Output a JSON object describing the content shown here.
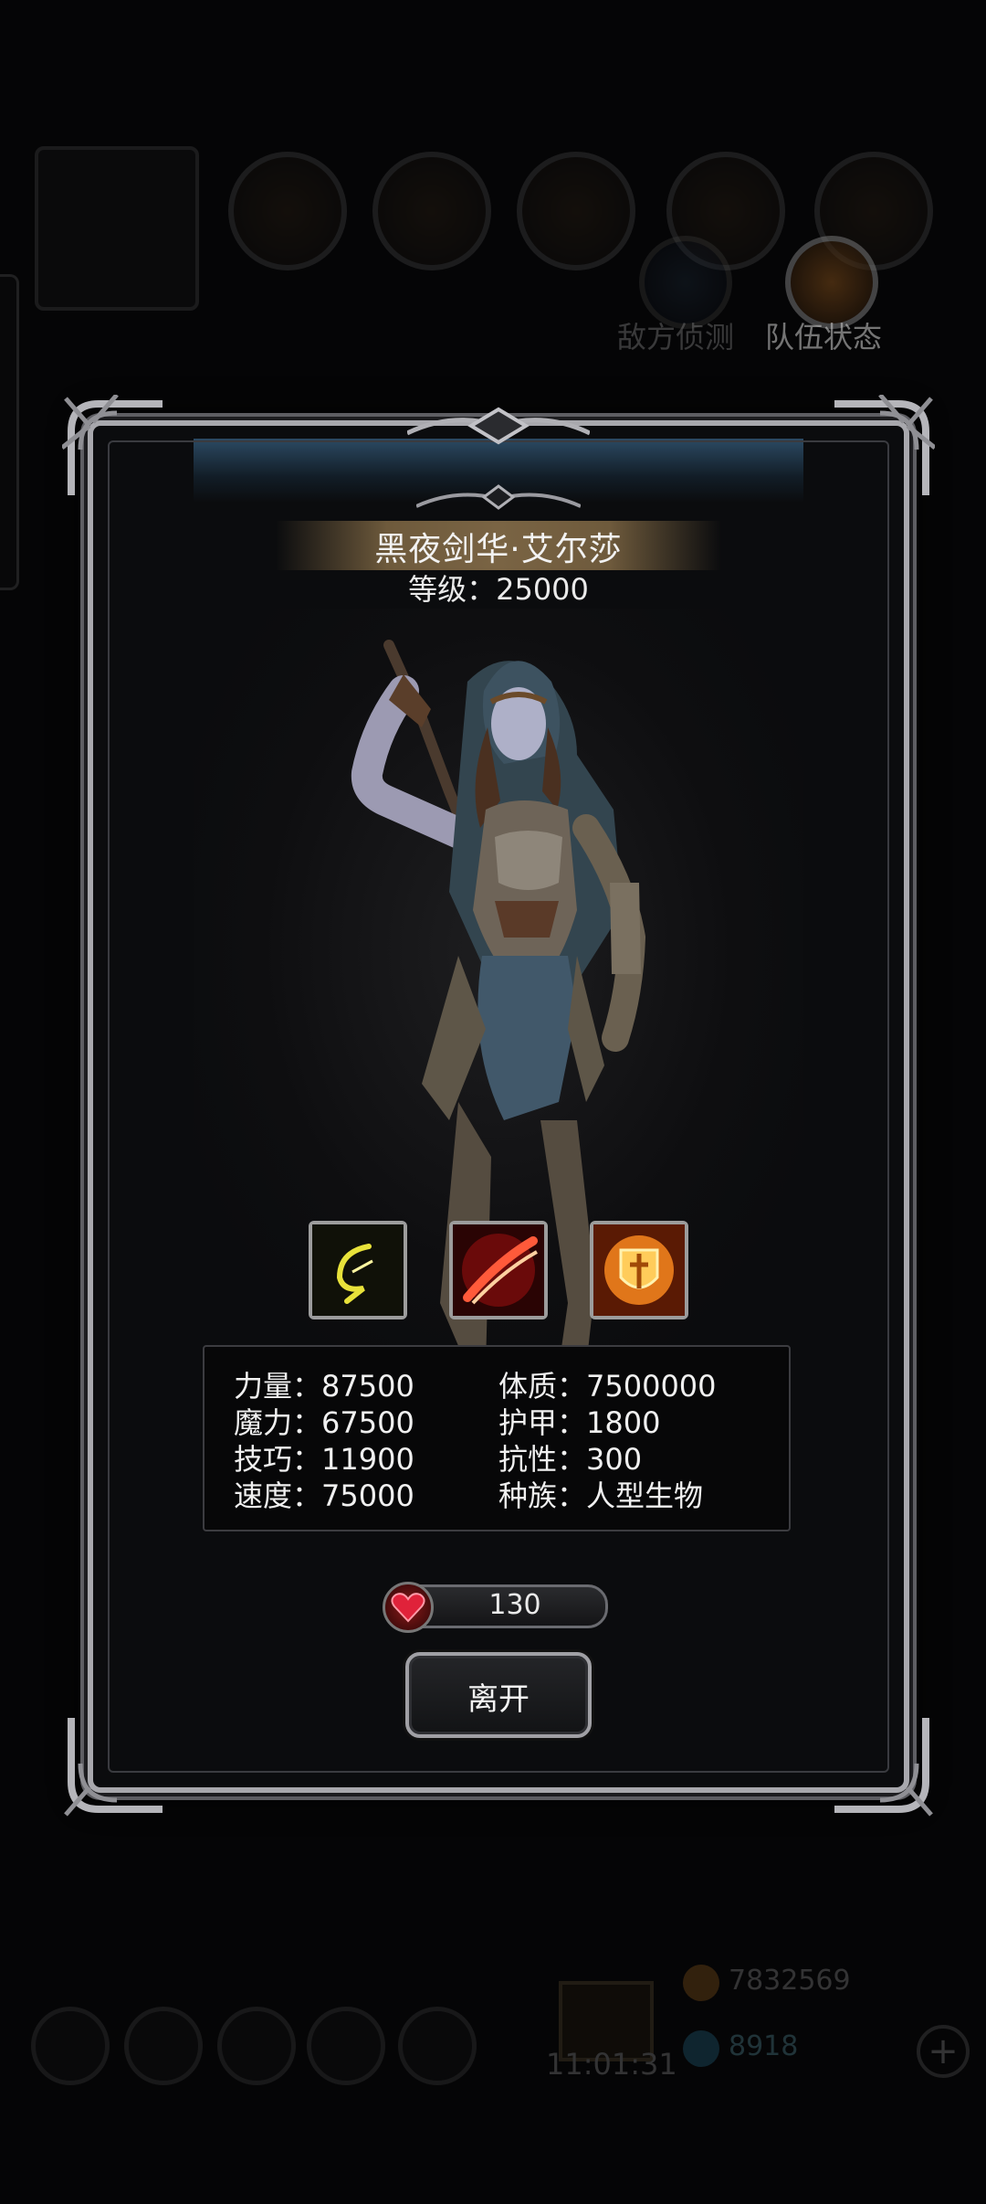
{
  "background": {
    "top_labels": [
      "敌方侦测",
      "队伍状态"
    ],
    "time": "11:01:31",
    "resource_gold": "7832569",
    "resource_gem": "8918"
  },
  "hero": {
    "name": "黑夜剑华·艾尔莎",
    "level_text": "等级：25000"
  },
  "skills": [
    {
      "icon": "lightning-arc-icon"
    },
    {
      "icon": "fire-slash-icon"
    },
    {
      "icon": "holy-shield-icon"
    }
  ],
  "stats": {
    "left": [
      "力量：87500",
      "魔力：67500",
      "技巧：11900",
      "速度：75000"
    ],
    "right": [
      "体质：7500000",
      "护甲：1800",
      "抗性：300",
      "种族：人型生物"
    ]
  },
  "hp": {
    "value": "130"
  },
  "leave_label": "离开",
  "colors": {
    "frame": "#a8a8ad",
    "title_bar": "#7a6444",
    "top_glow": "#2c4a63",
    "heart": "#c0182a"
  }
}
